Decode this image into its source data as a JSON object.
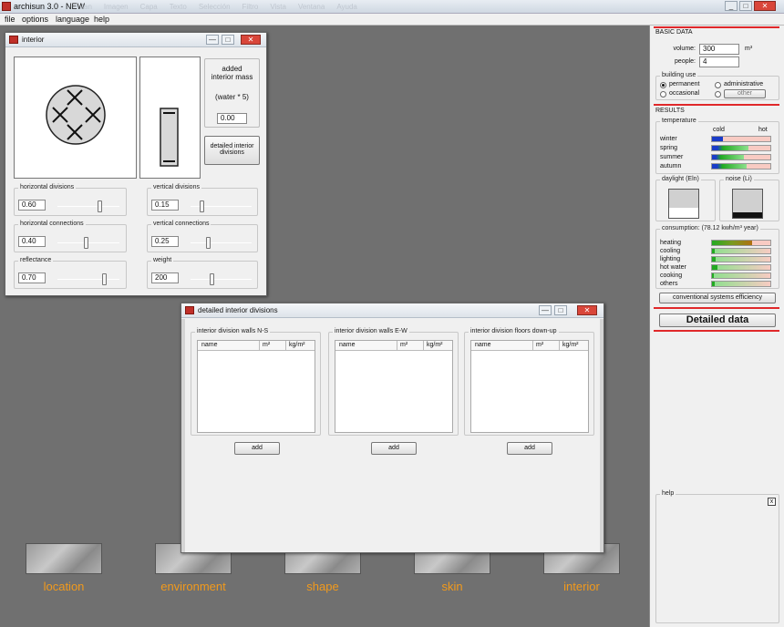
{
  "app": {
    "title": "archisun 3.0 - NEW",
    "ghost_menu": [
      "Jan",
      "Imagen",
      "Capa",
      "Texto",
      "Selección",
      "Filtro",
      "Vista",
      "Ventana",
      "Ayuda"
    ],
    "window_controls": [
      "_",
      "□",
      "✕"
    ]
  },
  "menu": [
    "file",
    "options",
    "language",
    "help"
  ],
  "interior_window": {
    "title": "interior",
    "controls": [
      "—",
      "□",
      "✕"
    ],
    "added_mass": {
      "line1": "added",
      "line2": "interior mass",
      "formula": "(water * 5)",
      "value": "0.00"
    },
    "detailed_button": {
      "line1": "detailed interior",
      "line2": "divisions"
    },
    "groups": [
      {
        "label": "horizontal divisions",
        "value": "0.60",
        "level": 0.68
      },
      {
        "label": "vertical divisions",
        "value": "0.15",
        "level": 0.18
      },
      {
        "label": "horizontal connections",
        "value": "0.40",
        "level": 0.45
      },
      {
        "label": "vertical connections",
        "value": "0.25",
        "level": 0.28
      },
      {
        "label": "reflectance",
        "value": "0.70",
        "level": 0.75
      },
      {
        "label": "weight",
        "value": "200",
        "level": 0.35
      }
    ]
  },
  "detail_window": {
    "title": "detailed interior divisions",
    "controls": [
      "—",
      "□",
      "✕"
    ],
    "panels": [
      {
        "label": "interior division walls N-S",
        "cols": [
          "name",
          "m²",
          "kg/m²"
        ],
        "button": "add"
      },
      {
        "label": "interior division walls E-W",
        "cols": [
          "name",
          "m²",
          "kg/m²"
        ],
        "button": "add"
      },
      {
        "label": "interior division floors down-up",
        "cols": [
          "name",
          "m²",
          "kg/m²"
        ],
        "button": "add"
      }
    ]
  },
  "nav": [
    {
      "label": "location"
    },
    {
      "label": "environment"
    },
    {
      "label": "shape"
    },
    {
      "label": "skin"
    },
    {
      "label": "interior"
    }
  ],
  "basic_data": {
    "heading": "BASIC DATA",
    "volume_label": "volume:",
    "volume_value": "300",
    "volume_unit": "m³",
    "people_label": "people:",
    "people_value": "4",
    "building_use_label": "building use",
    "use_options": [
      "permanent",
      "administrative",
      "occasional",
      "other"
    ],
    "selected_use": "permanent"
  },
  "results": {
    "heading": "RESULTS",
    "temperature_label": "temperature",
    "cold_label": "cold",
    "hot_label": "hot",
    "temperature_rows": [
      {
        "label": "winter",
        "value": 0.18,
        "color": "#1a3cc8"
      },
      {
        "label": "spring",
        "value": 0.62,
        "color": "#22aa22"
      },
      {
        "label": "summer",
        "value": 0.55,
        "color": "#22aa22"
      },
      {
        "label": "autumn",
        "value": 0.6,
        "color": "#22aa22"
      }
    ],
    "daylight_label": "daylight (Eln)",
    "daylight_level": 0.35,
    "noise_label": "noise (Li)",
    "noise_level": 0.18,
    "consumption_label": "consumption: (78.12 kwh/m³ year)",
    "consumption_rows": [
      {
        "label": "heating",
        "value": 0.68
      },
      {
        "label": "cooling",
        "value": 0.04
      },
      {
        "label": "lighting",
        "value": 0.06
      },
      {
        "label": "hot water",
        "value": 0.1
      },
      {
        "label": "cooking",
        "value": 0.03
      },
      {
        "label": "others",
        "value": 0.04
      }
    ],
    "efficiency_button": "conventional systems efficiency",
    "detailed_data_button": "Detailed data"
  },
  "help": {
    "label": "help",
    "close": "x"
  }
}
